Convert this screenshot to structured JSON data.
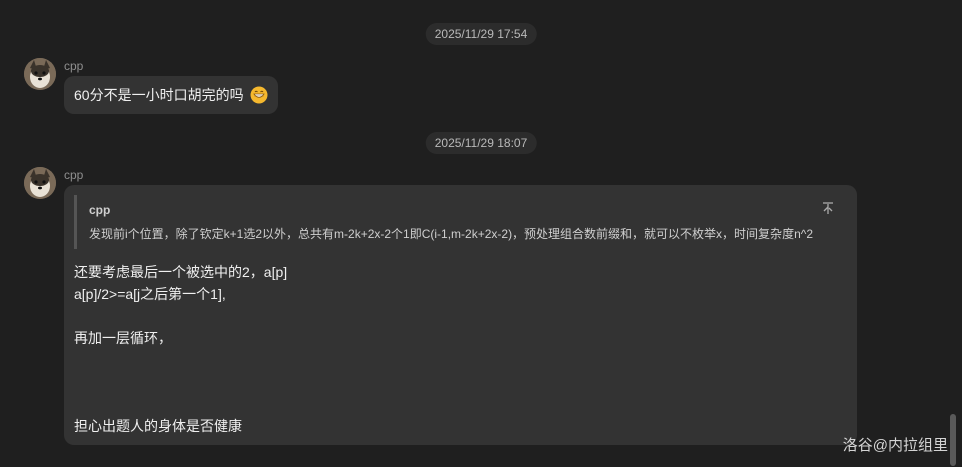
{
  "messages": [
    {
      "timestamp": "2025/11/29 17:54",
      "sender": "cpp",
      "text": "60分不是一小时口胡完的吗",
      "emoji": "grinning-face-icon"
    },
    {
      "timestamp": "2025/11/29 18:07",
      "sender": "cpp",
      "quote": {
        "sender": "cpp",
        "text": "发现前i个位置，除了钦定k+1选2以外，总共有m-2k+2x-2个1即C(i-1,m-2k+2x-2)，预处理组合数前缀和，就可以不枚举x，时间复杂度n^2"
      },
      "lines": [
        "还要考虑最后一个被选中的2，a[p]",
        "a[p]/2>=a[j之后第一个1],",
        "",
        "再加一层循环，",
        "",
        "",
        "",
        "担心出题人的身体是否健康"
      ]
    }
  ],
  "pin_icon_glyph": "不",
  "watermark": "洛谷@内拉组里"
}
